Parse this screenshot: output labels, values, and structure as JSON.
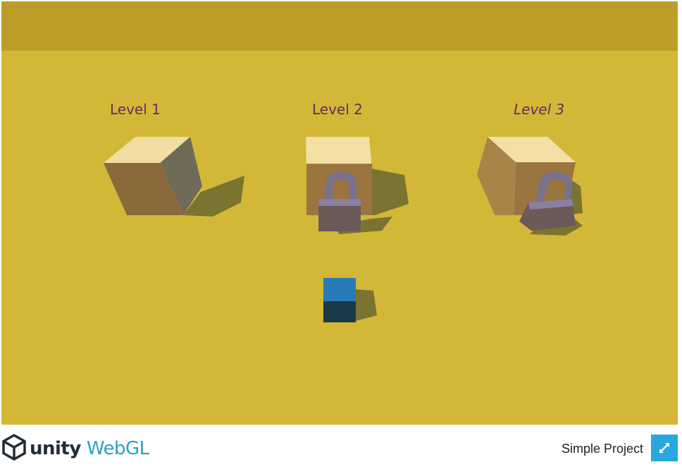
{
  "game": {
    "levels": [
      {
        "label": "Level 1",
        "locked": false
      },
      {
        "label": "Level 2",
        "locked": true
      },
      {
        "label": "Level 3",
        "locked": true
      }
    ],
    "colors": {
      "floor": "#d3b838",
      "back_wall": "#bc9d2a",
      "label": "#6b2a5a",
      "player": "#2a7ab8"
    }
  },
  "footer": {
    "logo_word": "unity",
    "logo_platform": "WebGL",
    "project_title": "Simple Project",
    "fullscreen_icon": "fullscreen-icon"
  }
}
